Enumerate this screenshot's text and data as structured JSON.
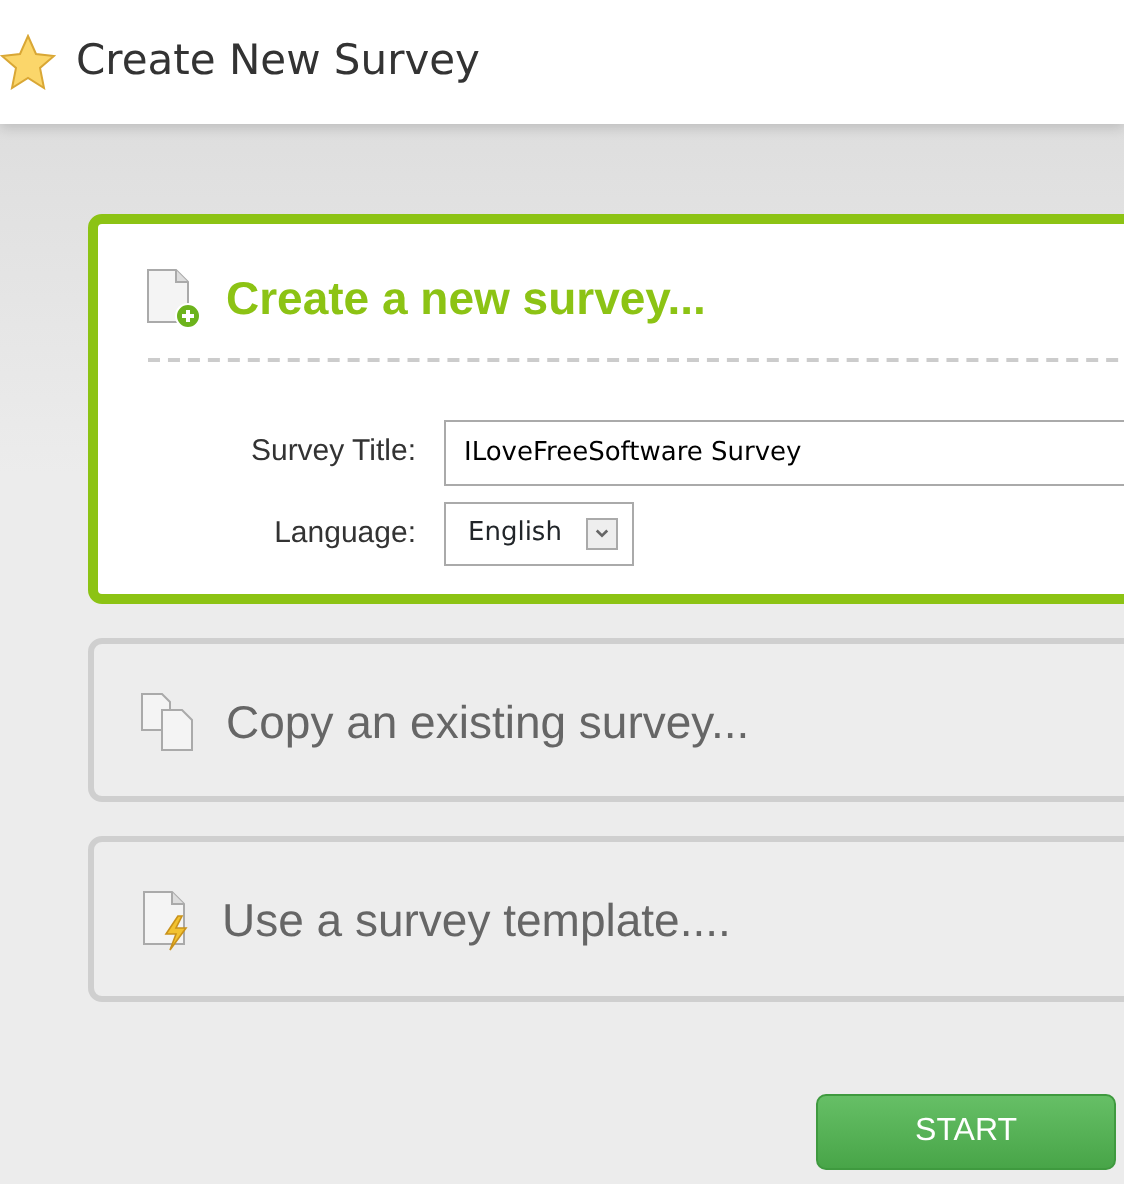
{
  "window": {
    "title": "Create New Survey"
  },
  "options": [
    {
      "kind": "new",
      "label": "Create a new survey...",
      "selected": true,
      "fields": [
        {
          "kind": "text",
          "label": "Survey Title:",
          "value": "ILoveFreeSoftware Survey"
        },
        {
          "kind": "select",
          "label": "Language:",
          "value": "English"
        }
      ]
    },
    {
      "kind": "copy",
      "label": "Copy an existing survey...",
      "selected": false
    },
    {
      "kind": "template",
      "label": "Use a survey template....",
      "selected": false
    }
  ],
  "buttons": [
    "START"
  ]
}
